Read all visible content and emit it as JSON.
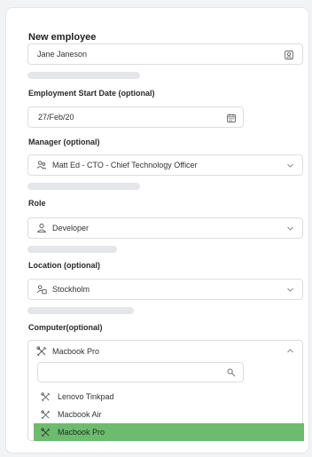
{
  "form": {
    "title": "New employee",
    "name": {
      "value": "Jane Janeson"
    },
    "start_date": {
      "label": "Employment Start Date (optional)",
      "value": "27/Feb/20"
    },
    "manager": {
      "label": "Manager (optional)",
      "value": "Matt Ed - CTO - Chief Technology Officer"
    },
    "role": {
      "label": "Role",
      "value": "Developer"
    },
    "location": {
      "label": "Location (optional)",
      "value": "Stockholm"
    },
    "computer": {
      "label": "Computer(optional)",
      "value": "Macbook Pro",
      "search_value": "",
      "options": [
        "Lenovo Tinkpad",
        "Macbook Air",
        "Macbook Pro"
      ],
      "selected_index": 2
    }
  },
  "colors": {
    "selected_option": "#6dbb6f",
    "border": "#dcdde1",
    "hint_bar": "#e4e6ea"
  }
}
